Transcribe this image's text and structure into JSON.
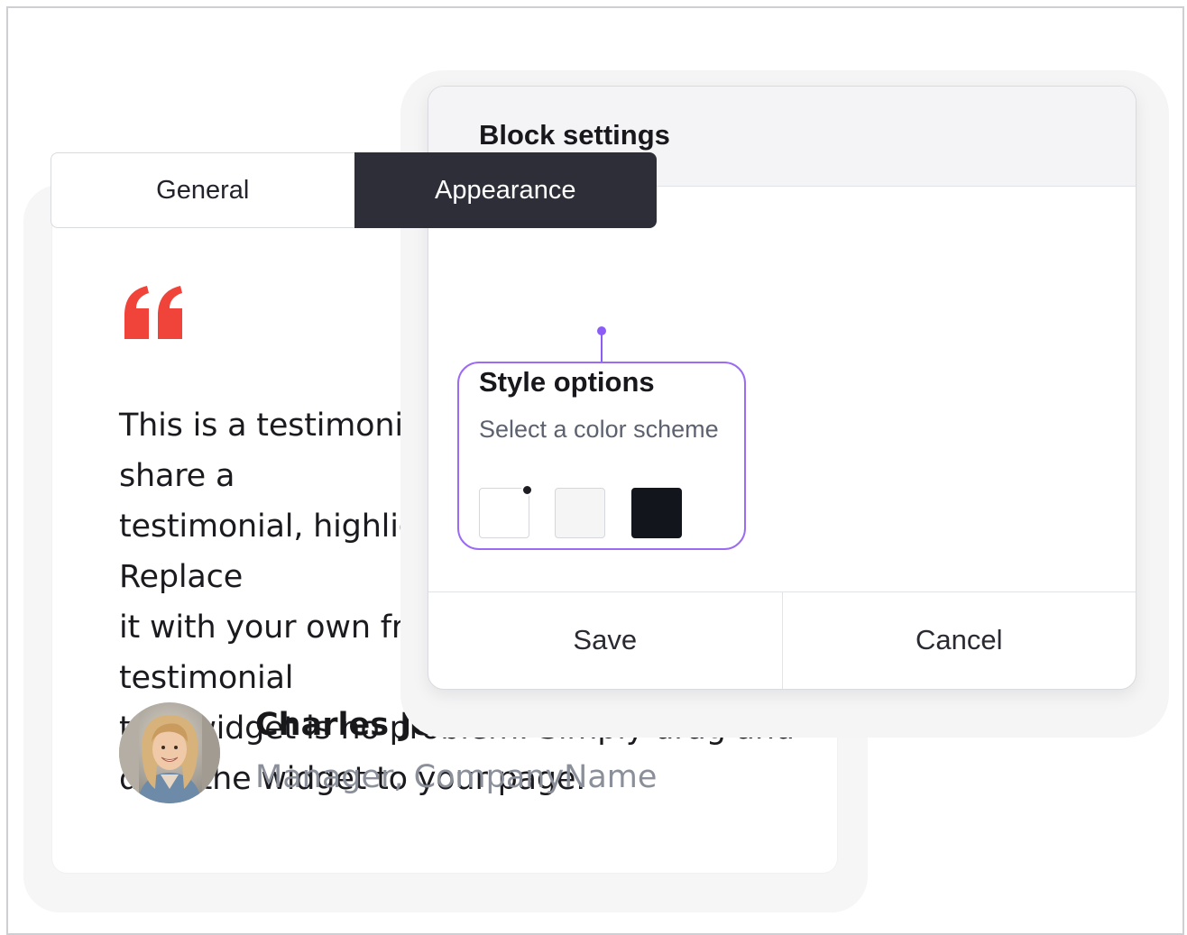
{
  "testimonial": {
    "quote_lines": [
      "This is a testimonial. Use this space to share a",
      "testimonial, highlighting your best work. Replace",
      "it with your own fresh text. Using this testimonial",
      "text widget is no problem. Simply drag and",
      "drop the widget to your page."
    ],
    "author_name": "Charles Jenkins",
    "author_role": "Manager, CompanyName",
    "quote_icon": "quote-icon",
    "accent_color": "#f0433a"
  },
  "block_settings": {
    "title": "Block settings",
    "tabs": [
      {
        "label": "General",
        "active": false
      },
      {
        "label": "Appearance",
        "active": true
      }
    ],
    "style_options": {
      "title": "Style options",
      "subtitle": "Select a color scheme",
      "swatches": [
        {
          "name": "white",
          "color": "#ffffff",
          "selected": true
        },
        {
          "name": "light-gray",
          "color": "#f5f5f6",
          "selected": false
        },
        {
          "name": "dark",
          "color": "#12161c",
          "selected": false
        }
      ],
      "highlight_color": "#9b6cf2"
    },
    "save_label": "Save",
    "cancel_label": "Cancel"
  }
}
